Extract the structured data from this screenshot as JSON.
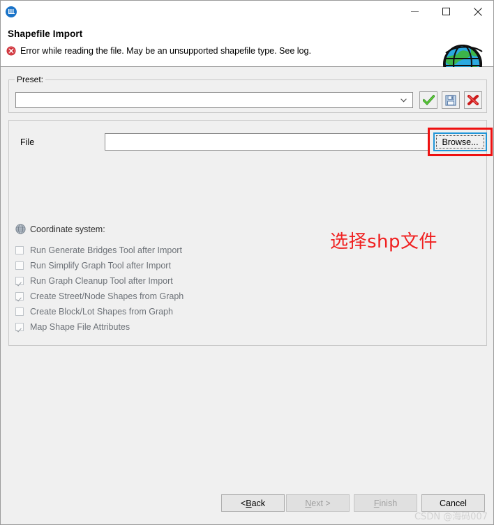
{
  "window": {
    "app_icon": "app-logo-icon",
    "controls": {
      "minimize": "minimize-icon",
      "maximize": "maximize-icon",
      "close": "close-icon"
    }
  },
  "header": {
    "title": "Shapefile Import",
    "error_icon": "error-icon",
    "error_message": "Error while reading the file. May be an unsupported shapefile type. See log.",
    "side_icon": "globe-icon"
  },
  "preset": {
    "legend": "Preset:",
    "combo_value": "",
    "combo_placeholder": "",
    "dropdown_icon": "chevron-down-icon",
    "buttons": [
      {
        "name": "apply-preset-button",
        "icon": "green-check-icon"
      },
      {
        "name": "save-preset-button",
        "icon": "floppy-disk-icon"
      },
      {
        "name": "delete-preset-button",
        "icon": "red-x-icon"
      }
    ]
  },
  "file_section": {
    "file_label": "File",
    "file_value": "",
    "browse_label": "Browse...",
    "coordinate_icon": "globe-wireframe-icon",
    "coordinate_label": "Coordinate system:",
    "options": [
      {
        "label": "Run Generate Bridges Tool after Import",
        "checked": false
      },
      {
        "label": "Run Simplify Graph Tool after Import",
        "checked": false
      },
      {
        "label": "Run Graph Cleanup Tool after Import",
        "checked": true
      },
      {
        "label": "Create Street/Node Shapes from Graph",
        "checked": true
      },
      {
        "label": "Create Block/Lot Shapes from Graph",
        "checked": false
      },
      {
        "label": "Map Shape File Attributes",
        "checked": true
      }
    ]
  },
  "annotation": {
    "text": "选择shp文件",
    "color": "#f02020",
    "highlight_color": "#ee1111",
    "highlight_target": "Browse..."
  },
  "footer": {
    "back": "< Back",
    "next": "Next >",
    "finish": "Finish",
    "cancel": "Cancel"
  },
  "watermark": "CSDN @海码007"
}
